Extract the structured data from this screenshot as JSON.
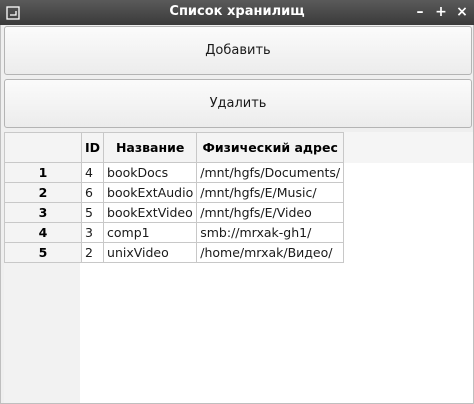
{
  "window": {
    "title": "Список хранилищ",
    "minimize_label": "–",
    "maximize_label": "+",
    "close_label": "×"
  },
  "toolbar": {
    "add_label": "Добавить",
    "delete_label": "Удалить"
  },
  "table": {
    "headers": [
      "ID",
      "Название",
      "Физический адрес"
    ],
    "rows": [
      {
        "num": "1",
        "id": "4",
        "name": "bookDocs",
        "path": "/mnt/hgfs/Documents/"
      },
      {
        "num": "2",
        "id": "6",
        "name": "bookExtAudio",
        "path": "/mnt/hgfs/E/Music/"
      },
      {
        "num": "3",
        "id": "5",
        "name": "bookExtVideo",
        "path": "/mnt/hgfs/E/Video"
      },
      {
        "num": "4",
        "id": "3",
        "name": "comp1",
        "path": "smb://mrxak-gh1/"
      },
      {
        "num": "5",
        "id": "2",
        "name": "unixVideo",
        "path": "/home/mrxak/Видео/"
      }
    ]
  }
}
